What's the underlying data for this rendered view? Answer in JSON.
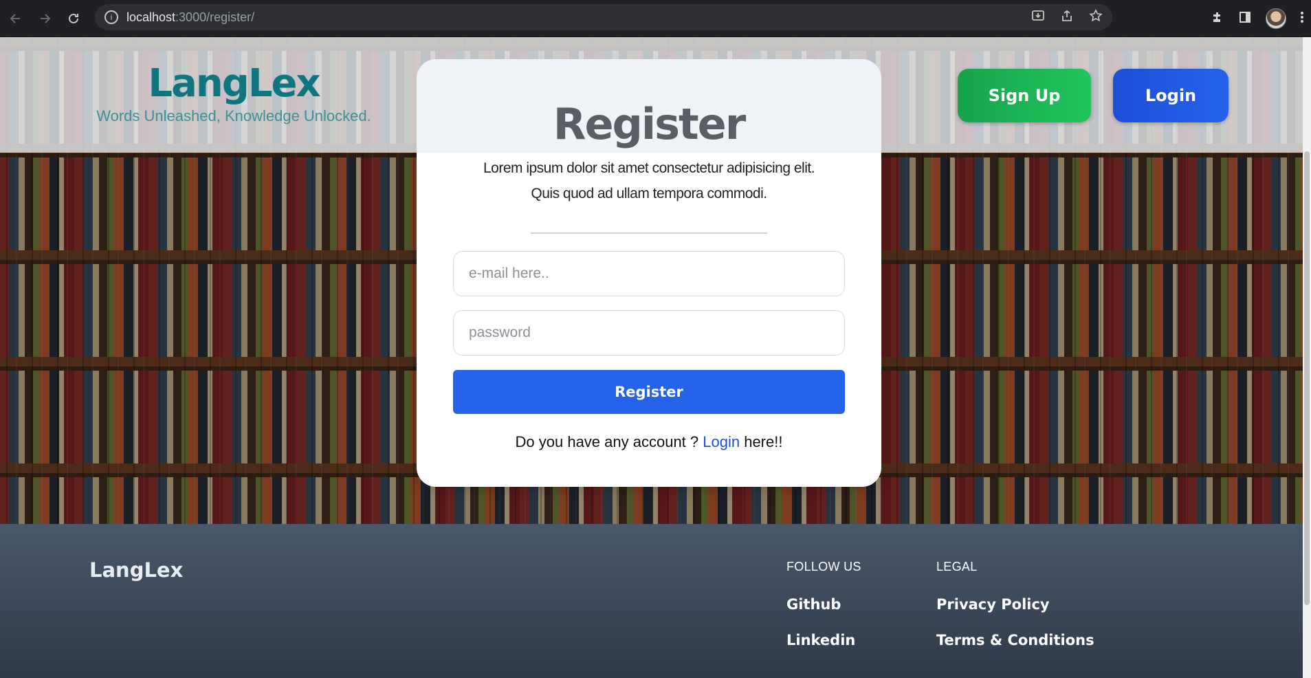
{
  "browser": {
    "url_host": "localhost",
    "url_path": ":3000/register/"
  },
  "header": {
    "brand": "LangLex",
    "tagline": "Words Unleashed, Knowledge Unlocked.",
    "signup_label": "Sign Up",
    "login_label": "Login"
  },
  "card": {
    "title": "Register",
    "description": "Lorem ipsum dolor sit amet consectetur adipisicing elit. Quis quod ad ullam tempora commodi.",
    "email_placeholder": "e-mail here..",
    "password_placeholder": "password",
    "submit_label": "Register",
    "account_prefix": "Do you have any account ? ",
    "account_link": "Login",
    "account_suffix": " here!!"
  },
  "footer": {
    "brand": "LangLex",
    "follow_heading": "FOLLOW US",
    "follow_links": [
      "Github",
      "Linkedin"
    ],
    "legal_heading": "LEGAL",
    "legal_links": [
      "Privacy Policy",
      "Terms & Conditions"
    ]
  },
  "colors": {
    "brand_teal": "#0f7680",
    "signup_green": "#22c55e",
    "login_blue": "#1d4ed8",
    "register_blue": "#2563eb",
    "footer_bg": "#3d4a5c"
  }
}
